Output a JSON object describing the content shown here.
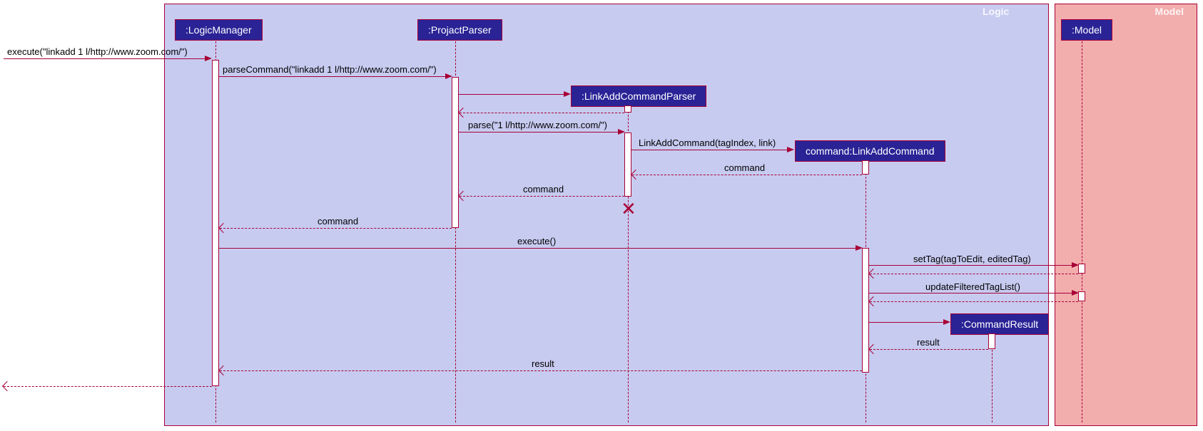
{
  "frames": {
    "logic_title": "Logic",
    "model_title": "Model"
  },
  "participants": {
    "logic_manager": ":LogicManager",
    "projact_parser": ":ProjactParser",
    "link_add_parser": ":LinkAddCommandParser",
    "link_add_command": "command:LinkAddCommand",
    "model": ":Model",
    "command_result": ":CommandResult"
  },
  "messages": {
    "execute_in": "execute(\"linkadd 1 l/http://www.zoom.com/\")",
    "parse_command": "parseCommand(\"linkadd 1 l/http://www.zoom.com/\")",
    "parse": "parse(\"1 l/http://www.zoom.com/\")",
    "link_add_cmd_ctor": "LinkAddCommand(tagIndex, link)",
    "return_command1": "command",
    "return_command2": "command",
    "return_command3": "command",
    "execute": "execute()",
    "set_tag": "setTag(tagToEdit, editedTag)",
    "update_filtered": "updateFilteredTagList()",
    "return_result1": "result",
    "return_result2": "result"
  },
  "colors": {
    "frame_logic_bg": "#c7cbf0",
    "frame_model_bg": "#f2adad",
    "line": "#a80036",
    "participant_bg": "#2a2396"
  }
}
